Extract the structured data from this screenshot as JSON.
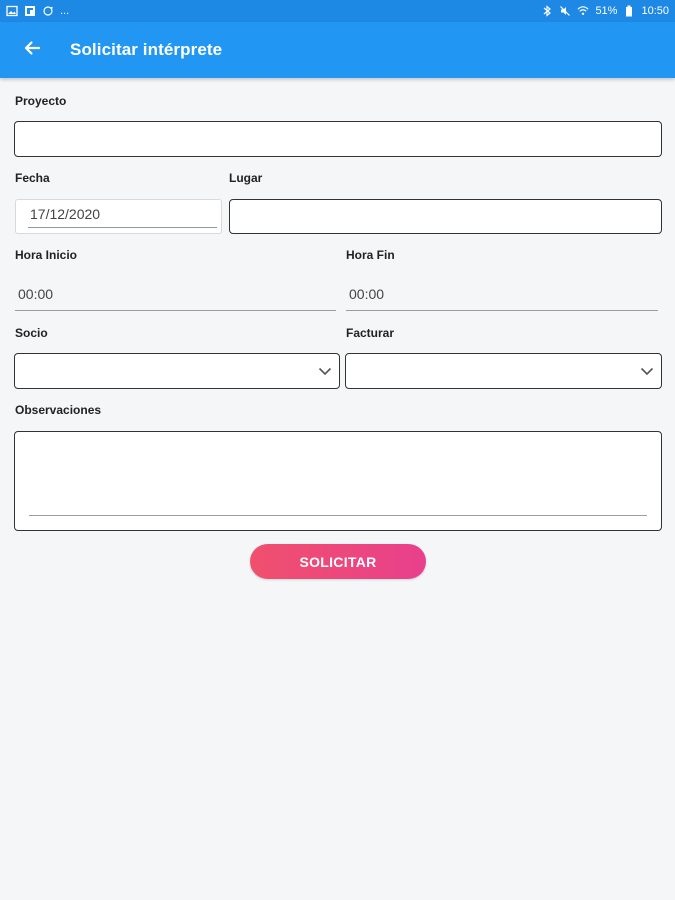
{
  "statusbar": {
    "left_text": "...",
    "battery": "51%",
    "time": "10:50"
  },
  "appbar": {
    "title": "Solicitar intérprete",
    "back_icon": "arrow-left-icon"
  },
  "form": {
    "proyecto_label": "Proyecto",
    "proyecto_value": "",
    "fecha_label": "Fecha",
    "fecha_value": "17/12/2020",
    "lugar_label": "Lugar",
    "lugar_value": "",
    "hora_inicio_label": "Hora Inicio",
    "hora_inicio_value": "00:00",
    "hora_fin_label": "Hora Fin",
    "hora_fin_value": "00:00",
    "socio_label": "Socio",
    "socio_value": "",
    "facturar_label": "Facturar",
    "facturar_value": "",
    "observaciones_label": "Observaciones",
    "observaciones_value": ""
  },
  "submit_label": "SOLICITAR",
  "colors": {
    "appbar": "#2196f3",
    "statusbar": "#1e88e5",
    "button_start": "#f0506e",
    "button_end": "#e8408c",
    "background": "#f5f6f8"
  }
}
